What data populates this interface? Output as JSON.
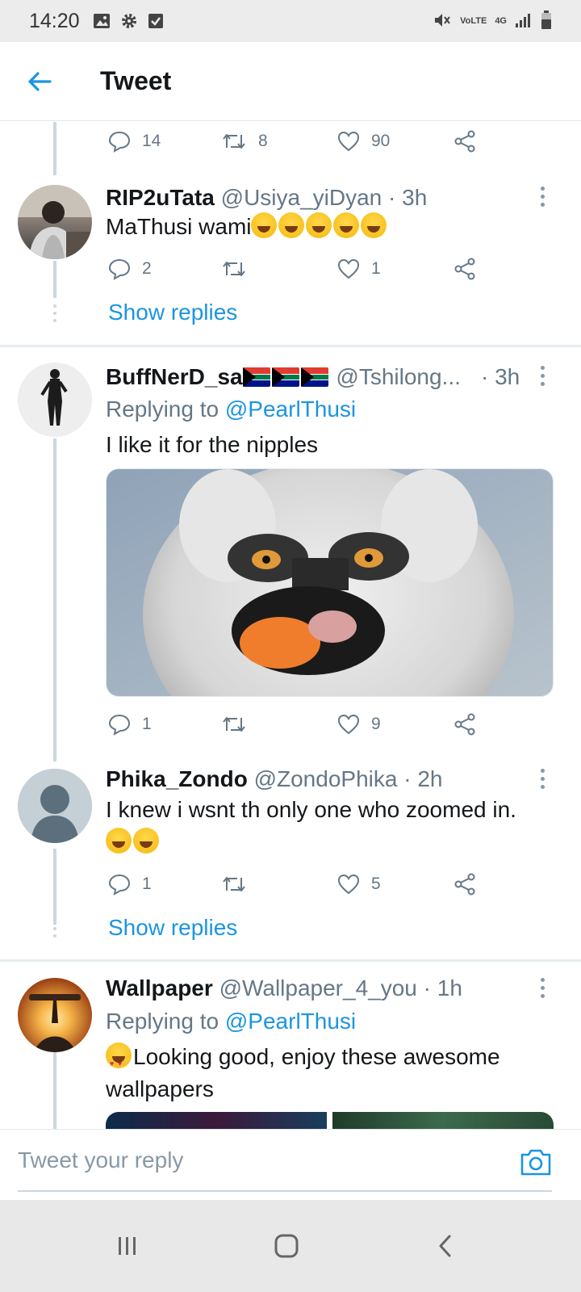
{
  "status_bar": {
    "time": "14:20",
    "left_icons": [
      "gallery-icon",
      "settings-icon",
      "checkbox-icon"
    ],
    "right_icons": [
      "mute-icon",
      "volte-icon",
      "4g-icon",
      "signal-icon",
      "battery-icon"
    ],
    "volte_label": "VoLTE",
    "network_label": "4G"
  },
  "header": {
    "title": "Tweet"
  },
  "top_actions": {
    "replies": "14",
    "retweets": "8",
    "likes": "90"
  },
  "tweets": [
    {
      "name": "RIP2uTata",
      "handle": "@Usiya_yiDyan",
      "time": "· 3h",
      "text": "MaThusi wami",
      "emoji_count": 5,
      "replies": "2",
      "retweets": "",
      "likes": "1",
      "show_replies": "Show replies"
    },
    {
      "name": "BuffNerD_sa",
      "handle": "@Tshilong...",
      "time": "· 3h",
      "replying_prefix": "Replying to",
      "replying_handle": "@PearlThusi",
      "text": "I like it for the nipples",
      "replies": "1",
      "retweets": "",
      "likes": "9"
    },
    {
      "name": "Phika_Zondo",
      "handle": "@ZondoPhika",
      "time": "· 2h",
      "text": "I knew i wsnt th only one who zoomed in.",
      "replies": "1",
      "retweets": "",
      "likes": "5",
      "show_replies": "Show replies"
    },
    {
      "name": "Wallpaper",
      "handle": "@Wallpaper_4_you",
      "time": "· 1h",
      "replying_prefix": "Replying to",
      "replying_handle": "@PearlThusi",
      "text": "Looking good, enjoy these awesome wallpapers"
    }
  ],
  "composer": {
    "placeholder": "Tweet your reply"
  },
  "colors": {
    "accent": "#1b95e0",
    "muted": "#657786",
    "divider": "#e6ecf0"
  }
}
